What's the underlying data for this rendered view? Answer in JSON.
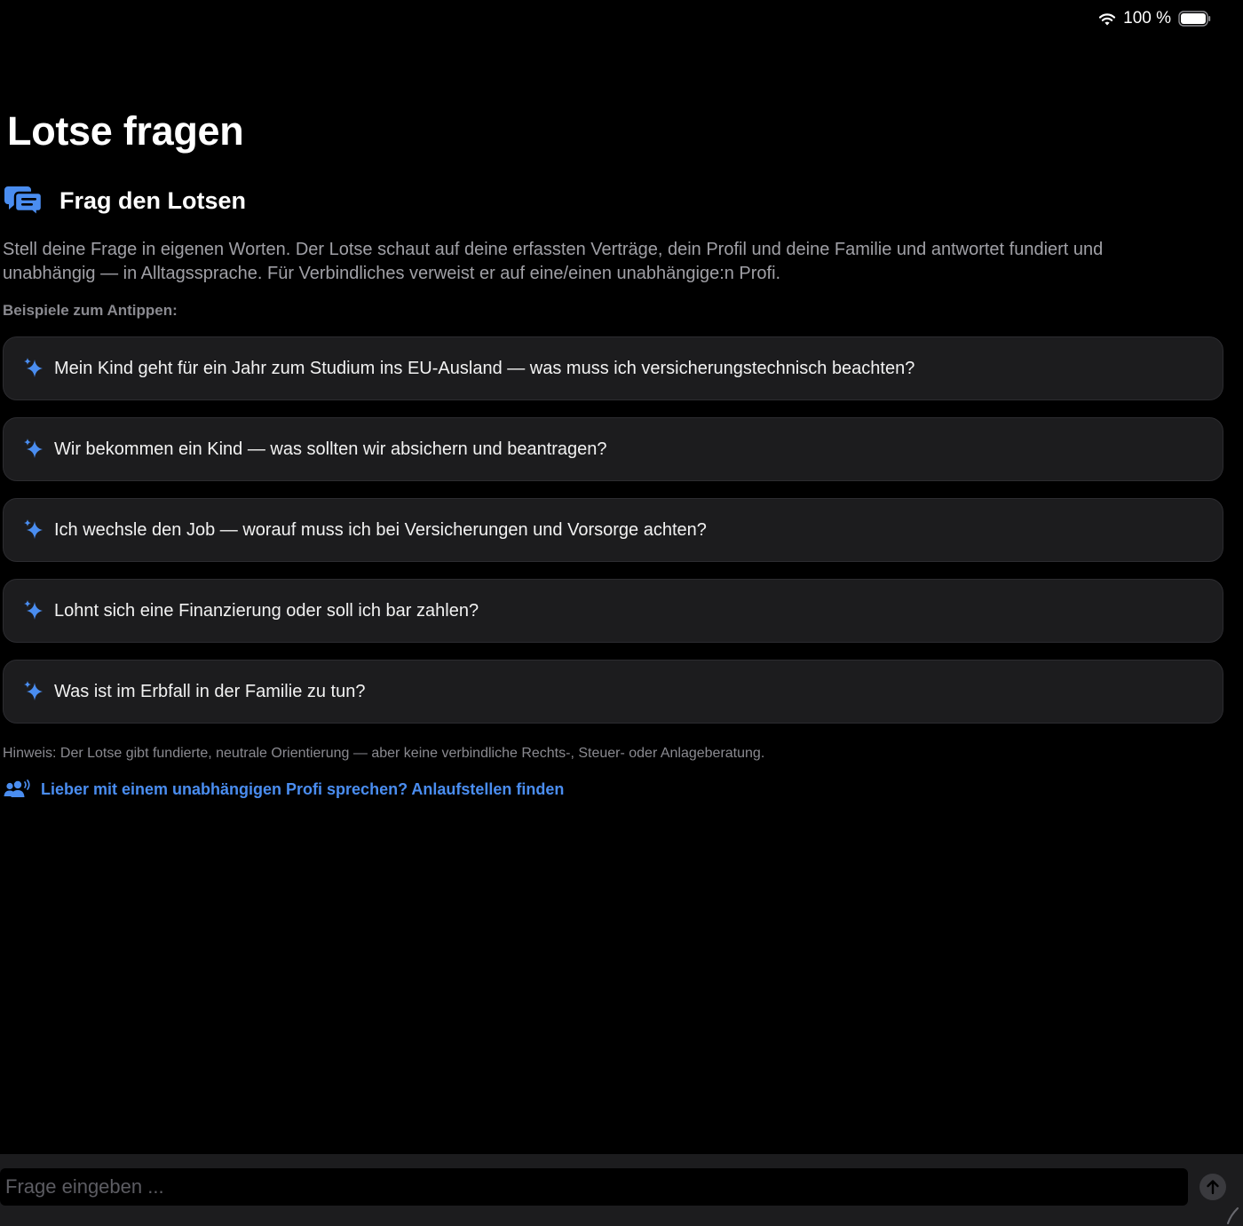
{
  "status": {
    "battery": "100 %"
  },
  "title": "Lotse fragen",
  "section": {
    "title": "Frag den Lotsen",
    "intro": "Stell deine Frage in eigenen Worten. Der Lotse schaut auf deine erfassten Verträge, dein Profil und deine Familie und antwortet fundiert und unabhängig — in Alltagssprache. Für Verbindliches verweist er auf eine/einen unabhängige:n Profi.",
    "examples_label": "Beispiele zum Antippen:"
  },
  "examples": [
    "Mein Kind geht für ein Jahr zum Studium ins EU-Ausland — was muss ich versicherungstechnisch beachten?",
    "Wir bekommen ein Kind — was sollten wir absichern und beantragen?",
    "Ich wechsle den Job — worauf muss ich bei Versicherungen und Vorsorge achten?",
    "Lohnt sich eine Finanzierung oder soll ich bar zahlen?",
    "Was ist im Erbfall in der Familie zu tun?"
  ],
  "hint": "Hinweis: Der Lotse gibt fundierte, neutrale Orientierung — aber keine verbindliche Rechts-, Steuer- oder Anlageberatung.",
  "pro_link": "Lieber mit einem unabhängigen Profi sprechen? Anlaufstellen finden",
  "input": {
    "placeholder": "Frage eingeben ..."
  },
  "colors": {
    "accent": "#4a8df0",
    "card": "#1c1c1e",
    "muted": "#a0a0a6"
  }
}
